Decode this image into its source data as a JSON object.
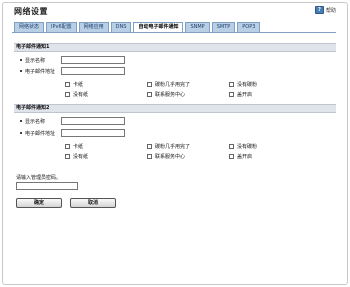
{
  "page": {
    "title": "网络设置",
    "help_label": "帮助"
  },
  "tabs": [
    {
      "label": "网络状态"
    },
    {
      "label": "IPv6配置"
    },
    {
      "label": "网络应用"
    },
    {
      "label": "DNS"
    },
    {
      "label": "自动电子邮件通知",
      "active": true
    },
    {
      "label": "SNMP"
    },
    {
      "label": "SMTP"
    },
    {
      "label": "POP3"
    }
  ],
  "notifications": [
    {
      "header": "电子邮件通知1",
      "display_name_label": "显示名称",
      "display_name_value": "",
      "email_label": "电子邮件地址",
      "email_value": "",
      "options": [
        "卡纸",
        "碳粉几乎用完了",
        "没有碳粉",
        "没有纸",
        "联系服务中心",
        "盖开启"
      ]
    },
    {
      "header": "电子邮件通知2",
      "display_name_label": "显示名称",
      "display_name_value": "",
      "email_label": "电子邮件地址",
      "email_value": "",
      "options": [
        "卡纸",
        "碳粉几乎用完了",
        "没有碳粉",
        "没有纸",
        "联系服务中心",
        "盖开启"
      ]
    }
  ],
  "admin": {
    "password_label": "请输入管理员密码。",
    "password_value": ""
  },
  "buttons": {
    "ok": "确定",
    "cancel": "取消"
  },
  "colors": {
    "tab_bg": "#b9cfe6",
    "tab_active_bg": "#ffffff",
    "section_header_bg": "#dfe3ea"
  }
}
